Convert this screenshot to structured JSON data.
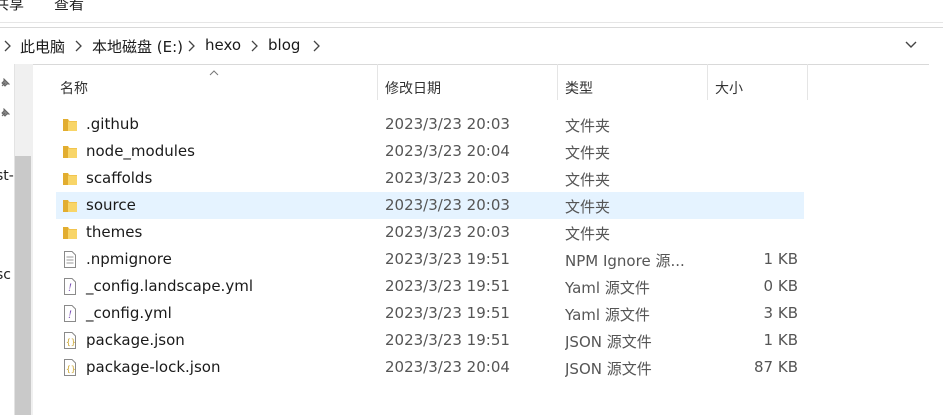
{
  "ribbon": {
    "tab_share": "共享",
    "tab_view": "查看"
  },
  "breadcrumb": [
    "此电脑",
    "本地磁盘 (E:)",
    "hexo",
    "blog"
  ],
  "nav_fragments": [
    "st-",
    "sc"
  ],
  "columns": {
    "name": "名称",
    "modified": "修改日期",
    "type": "类型",
    "size": "大小"
  },
  "files": [
    {
      "name": ".github",
      "modified": "2023/3/23 20:03",
      "type": "文件夹",
      "size": "",
      "icon": "folder-icon"
    },
    {
      "name": "node_modules",
      "modified": "2023/3/23 20:04",
      "type": "文件夹",
      "size": "",
      "icon": "folder-icon"
    },
    {
      "name": "scaffolds",
      "modified": "2023/3/23 20:03",
      "type": "文件夹",
      "size": "",
      "icon": "folder-icon"
    },
    {
      "name": "source",
      "modified": "2023/3/23 20:03",
      "type": "文件夹",
      "size": "",
      "icon": "folder-icon",
      "selected": true
    },
    {
      "name": "themes",
      "modified": "2023/3/23 20:03",
      "type": "文件夹",
      "size": "",
      "icon": "folder-icon"
    },
    {
      "name": ".npmignore",
      "modified": "2023/3/23 19:51",
      "type": "NPM Ignore 源...",
      "size": "1 KB",
      "icon": "text-file-icon"
    },
    {
      "name": "_config.landscape.yml",
      "modified": "2023/3/23 19:51",
      "type": "Yaml 源文件",
      "size": "0 KB",
      "icon": "yaml-file-icon"
    },
    {
      "name": "_config.yml",
      "modified": "2023/3/23 19:51",
      "type": "Yaml 源文件",
      "size": "3 KB",
      "icon": "yaml-file-icon"
    },
    {
      "name": "package.json",
      "modified": "2023/3/23 19:51",
      "type": "JSON 源文件",
      "size": "1 KB",
      "icon": "json-file-icon"
    },
    {
      "name": "package-lock.json",
      "modified": "2023/3/23 20:04",
      "type": "JSON 源文件",
      "size": "87 KB",
      "icon": "json-file-icon"
    }
  ],
  "colors": {
    "selection": "#e5f3ff",
    "folder": "#f2c44e",
    "json_icon": "#c9a227",
    "yaml_icon": "#7a4fb5"
  }
}
